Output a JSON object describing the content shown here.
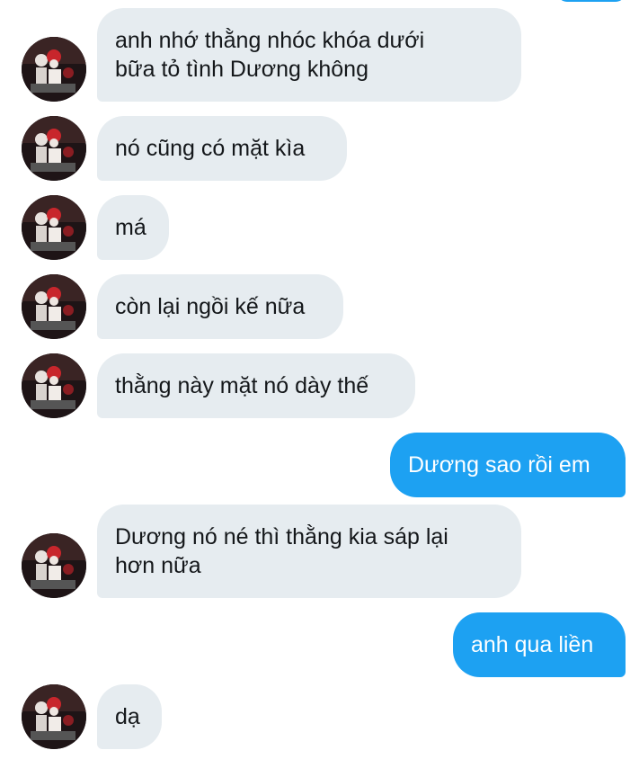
{
  "conversation": {
    "messages": [
      {
        "direction": "in",
        "text": "anh nhớ thằng nhóc khóa dưới\nbữa tỏ tình Dương không"
      },
      {
        "direction": "in",
        "text": "nó cũng có mặt kìa"
      },
      {
        "direction": "in",
        "text": "má"
      },
      {
        "direction": "in",
        "text": "còn lại ngồi kế nữa"
      },
      {
        "direction": "in",
        "text": "thằng này mặt nó dày thế"
      },
      {
        "direction": "out",
        "text": "Dương sao rồi em"
      },
      {
        "direction": "in",
        "text": "Dương nó né thì thằng kia sáp lại\nhơn nữa"
      },
      {
        "direction": "out",
        "text": "anh qua liền"
      },
      {
        "direction": "in",
        "text": "dạ"
      }
    ]
  },
  "colors": {
    "incoming_bubble": "#e6ecf0",
    "outgoing_bubble": "#1da1f2",
    "incoming_text": "#14171a",
    "outgoing_text": "#ffffff"
  },
  "icons": {
    "avatar": "contact-avatar-photo"
  }
}
